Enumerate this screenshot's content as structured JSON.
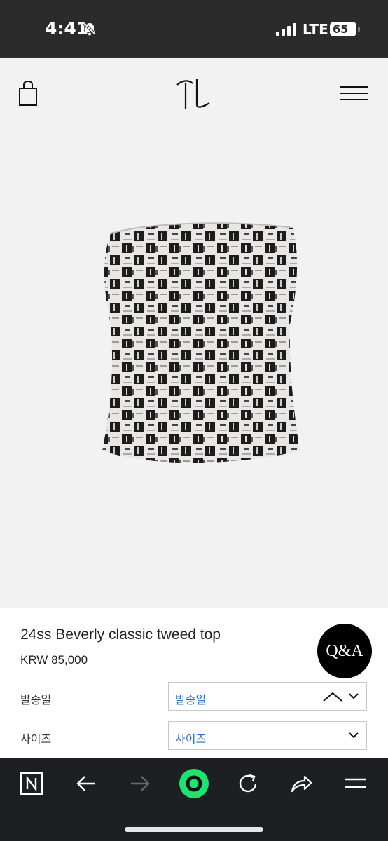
{
  "status_bar": {
    "time": "4:41",
    "network": "LTE",
    "battery": "65",
    "icons": [
      "bell-slash-icon",
      "signal-icon",
      "battery-icon"
    ]
  },
  "header": {
    "icons": [
      "shopping-bag-icon",
      "brand-logo",
      "hamburger-menu-icon"
    ]
  },
  "product": {
    "image": "tweed-top-product-image",
    "title": "24ss Beverly classic tweed top",
    "price": "KRW 85,000",
    "qa_button": "Q&A",
    "options": [
      {
        "label": "발송일",
        "selected": "발송일"
      },
      {
        "label": "사이즈",
        "selected": "사이즈"
      }
    ]
  },
  "browser_toolbar": {
    "icons": [
      "naver-n-icon",
      "back-arrow-icon",
      "forward-arrow-icon",
      "green-home-icon",
      "reload-icon",
      "share-icon",
      "menu-icon"
    ],
    "accent_color": "#1ee36f"
  }
}
